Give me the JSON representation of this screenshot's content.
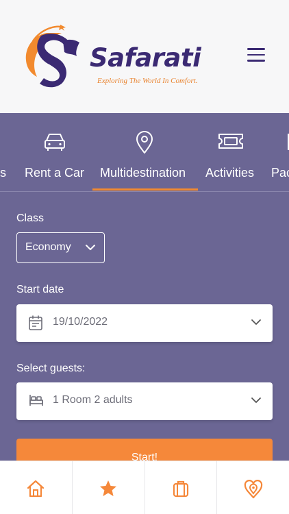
{
  "brand": {
    "name": "Safarati",
    "tagline": "Exploring The World In Comfort."
  },
  "tabs": [
    {
      "label": "rs",
      "icon": "partial-icon"
    },
    {
      "label": "Rent a Car",
      "icon": "car-icon"
    },
    {
      "label": "Multidestination",
      "icon": "location-pin-icon",
      "active": true
    },
    {
      "label": "Activities",
      "icon": "ticket-icon"
    },
    {
      "label": "Pac",
      "icon": "package-icon"
    }
  ],
  "form": {
    "class_label": "Class",
    "class_value": "Economy",
    "start_date_label": "Start date",
    "start_date_value": "19/10/2022",
    "guests_label": "Select guests:",
    "guests_value": "1 Room 2 adults",
    "start_button": "Start!"
  },
  "bottom_nav": [
    {
      "icon": "home-icon"
    },
    {
      "icon": "star-icon"
    },
    {
      "icon": "suitcase-icon"
    },
    {
      "icon": "heart-pin-icon"
    }
  ],
  "colors": {
    "background": "#6b6694",
    "accent": "#f5883a",
    "brand_dark": "#3b2a73",
    "header_bg": "#f7f7f8"
  }
}
